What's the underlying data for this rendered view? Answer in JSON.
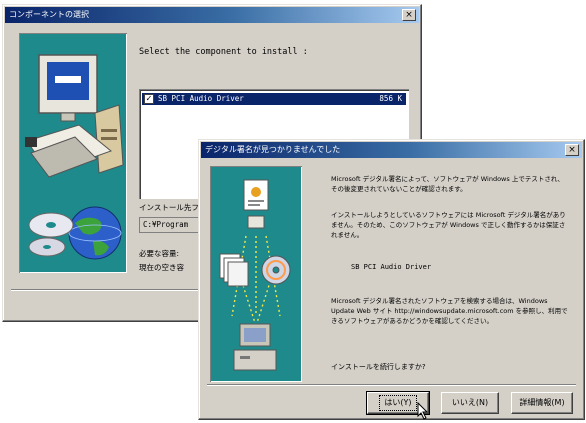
{
  "back_window": {
    "title": "コンポーネントの選択",
    "close_glyph": "×",
    "instruction": "Select the component to install :",
    "components": [
      {
        "checked": true,
        "name": "SB PCI Audio Driver",
        "size": "856 K"
      }
    ],
    "install_to_label": "インストール先フォ",
    "install_path": "C:¥Program",
    "space_required_label": "必要な容量:",
    "space_available_label": "現在の空き容"
  },
  "front_window": {
    "title": "デジタル署名が見つかりませんでした",
    "close_glyph": "×",
    "paragraph1": "Microsoft デジタル署名によって、ソフトウェアが Windows 上でテストされ、その後変更されていないことが確認されます。",
    "paragraph2": "インストールしようとしているソフトウェアには Microsoft デジタル署名がありません。そのため、このソフトウェアが Windows で正しく動作するかは保証されません。",
    "driver_name": "SB PCI Audio Driver",
    "paragraph3a": "Microsoft デジタル署名されたソフトウェアを検索する場合は、Windows Update Web サイト",
    "paragraph3b": "http://windowsupdate.microsoft.com を参照し、利用できるソフトウェアがあるかどうかを確認してください。",
    "question": "インストールを続行しますか?",
    "buttons": {
      "yes": "はい(Y)",
      "no": "いいえ(N)",
      "details": "詳細情報(M)"
    }
  },
  "icons": {
    "back_art": [
      "monitor-icon",
      "computer-icon",
      "keyboard-icon",
      "globe-icon",
      "disc-icon"
    ],
    "front_art": [
      "document-icon",
      "cd-icon",
      "computer-icon"
    ]
  },
  "colors": {
    "title_active": "#0a246a",
    "art_panel": "#1e8a8c",
    "selection": "#0a246a"
  }
}
